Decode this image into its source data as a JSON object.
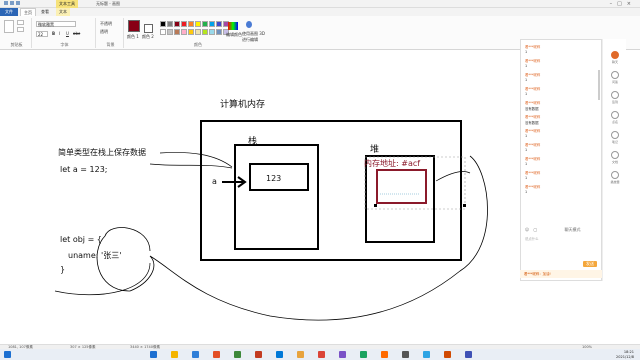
{
  "app": {
    "title": "无标题 - 画图",
    "context_tab": "文本工具",
    "tabs": [
      "文件",
      "主页",
      "查看",
      "文本"
    ]
  },
  "ribbon": {
    "groups": [
      "剪贴板",
      "字体",
      "背景",
      "颜色"
    ],
    "font_name": "微软雅黑",
    "font_size": "22",
    "opaque_label": "不透明",
    "transparent_label": "透明",
    "color1_label": "颜色 1",
    "color2_label": "颜色 2",
    "edit_colors_label": "编辑颜色",
    "paint3d_label": "使用画图 3D 进行编辑",
    "palette": [
      "#000000",
      "#7f7f7f",
      "#880015",
      "#ed1c24",
      "#ff7f27",
      "#fff200",
      "#22b14c",
      "#00a2e8",
      "#3f48cc",
      "#a349a4",
      "#ffffff",
      "#c3c3c3",
      "#b97a57",
      "#ffaec9",
      "#ffc90e",
      "#efe4b0",
      "#b5e61d",
      "#99d9ea",
      "#7092be",
      "#c8bfe7"
    ],
    "color1": "#880015",
    "color2": "#ffffff"
  },
  "canvas": {
    "heading": "计算机内存",
    "stack_label": "栈",
    "heap_label": "堆",
    "simple_type_note": "简单类型在栈上保存数据",
    "let_a": "let  a = 123;",
    "var_a": "a",
    "value_123": "123",
    "heap_address": "内存地址: #acf",
    "let_obj": "let obj = {",
    "uname_line": "uname: '张三'",
    "close_brace": "}",
    "accent_color": "#8b1a2b"
  },
  "chat": {
    "messages": [
      {
        "user": "看***昵称",
        "text": "1"
      },
      {
        "user": "看***昵称",
        "text": "1"
      },
      {
        "user": "看***昵称",
        "text": "1"
      },
      {
        "user": "看***昵称",
        "text": "1"
      },
      {
        "user": "看***昵称",
        "text": "没有数据"
      },
      {
        "user": "看***昵称",
        "text": "没有数据"
      },
      {
        "user": "看***昵称",
        "text": "1"
      },
      {
        "user": "看***昵称",
        "text": "1"
      },
      {
        "user": "看***昵称",
        "text": "1"
      },
      {
        "user": "看***昵称",
        "text": "1"
      },
      {
        "user": "看***昵称",
        "text": "1"
      }
    ],
    "input_placeholder": "说点什么",
    "input_option": "聊天模式",
    "send_label": "发送",
    "bottom_notice": "看***昵称：加油!",
    "sidebar": [
      "聊天",
      "问答",
      "签到",
      "点名",
      "笔记",
      "文档",
      "播放器"
    ]
  },
  "statusbar": {
    "cursor": "1081, 107像素",
    "selection": "307 × 125像素",
    "size": "3440 × 1740像素",
    "zoom": "100%"
  },
  "taskbar": {
    "time": "18:21",
    "date": "2021/12/8",
    "icon_colors": [
      "#1c6fd1",
      "#f4b400",
      "#2f7ed8",
      "#e34f26",
      "#3c873a",
      "#c23b22",
      "#0078d7",
      "#e8a33d",
      "#db4437",
      "#7a52c7",
      "#1aa260",
      "#ff6a00",
      "#555555",
      "#2ea4e4",
      "#d04a02",
      "#3f51b5"
    ]
  }
}
